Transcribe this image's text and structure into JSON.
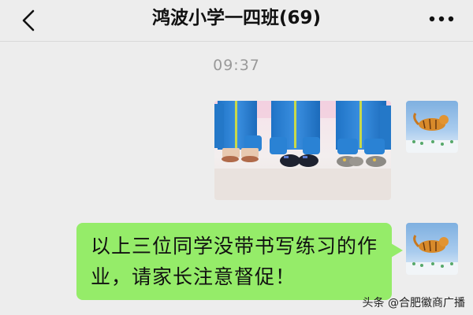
{
  "header": {
    "title": "鸿波小学一四班(69)",
    "back_icon": "chevron-left-icon",
    "more_icon": "more-dots-icon"
  },
  "chat": {
    "timestamp": "09:37",
    "messages": [
      {
        "type": "image",
        "sender": "self",
        "image_content": "three students' legs in blue school uniform trousers and shoes, standing against a white wall"
      },
      {
        "type": "text",
        "sender": "self",
        "text": "以上三位同学没带书写练习的作业，请家长注意督促！"
      }
    ]
  },
  "watermark": "头条 @合肥徽商广播",
  "colors": {
    "background": "#ededed",
    "bubble_self": "#95ec69",
    "timestamp": "#999999"
  }
}
